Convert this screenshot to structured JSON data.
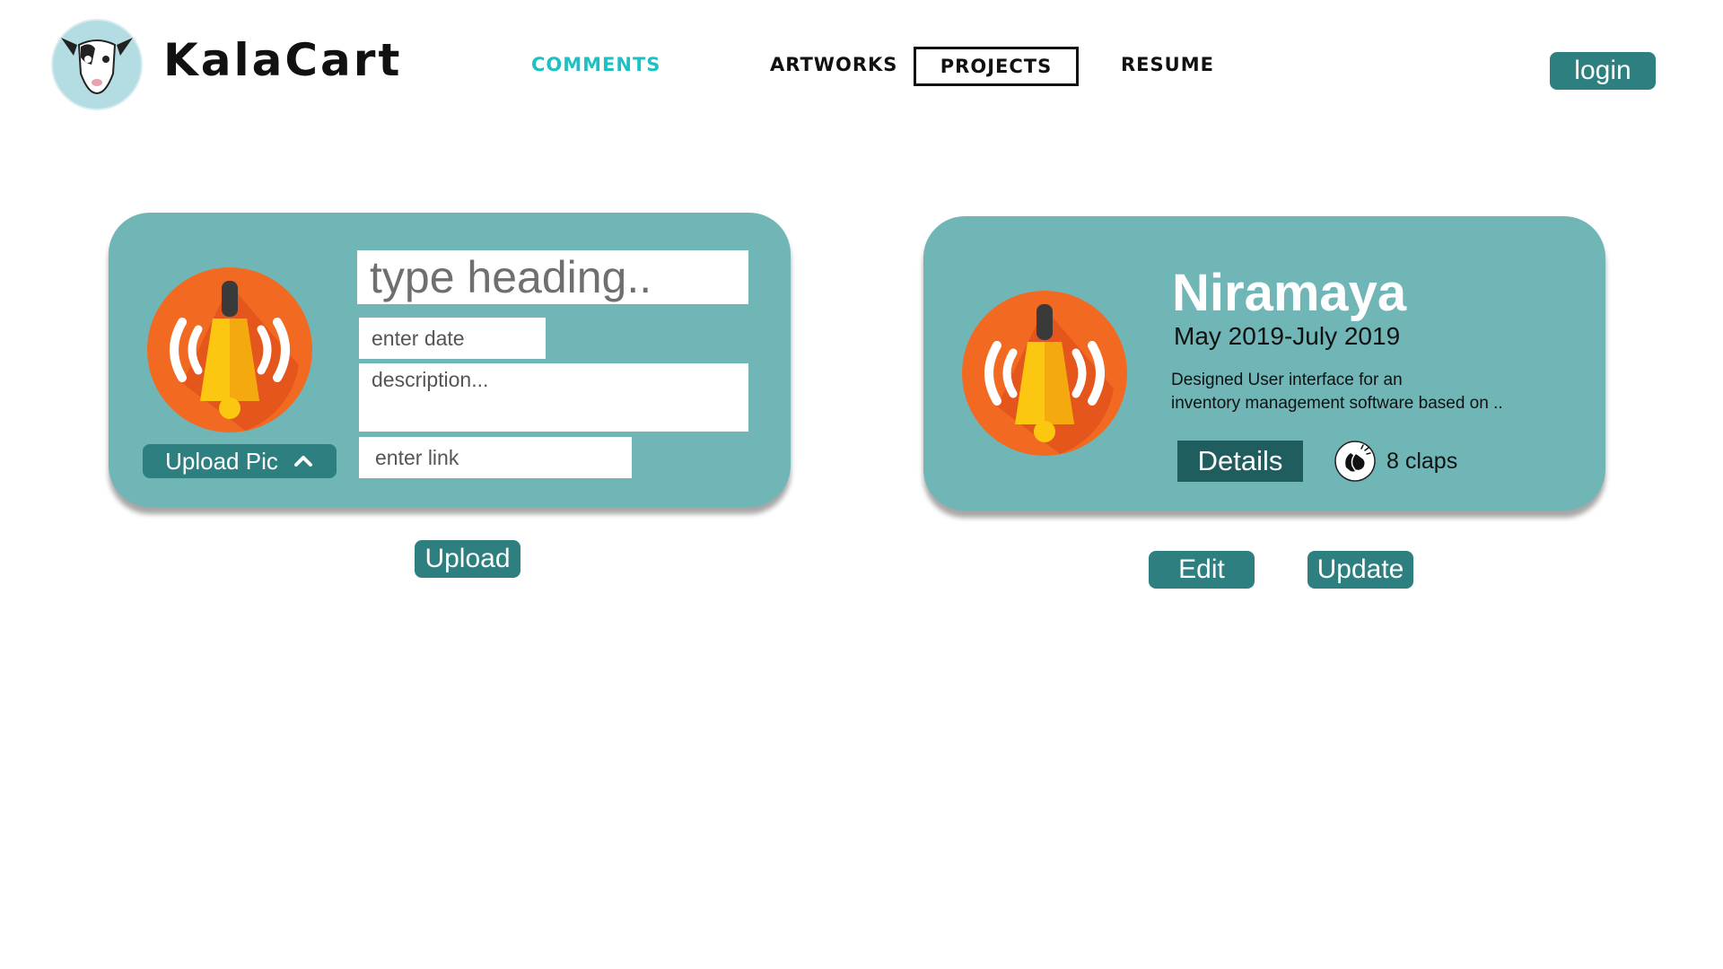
{
  "brand": {
    "name": "KalaCart",
    "logo_icon": "goat-logo-icon"
  },
  "nav": {
    "comments": "COMMENTS",
    "artworks": "ARTWORKS",
    "projects": "PROJECTS",
    "resume": "RESUME",
    "active": "COMMENTS"
  },
  "header": {
    "login_label": "login"
  },
  "editor": {
    "heading_placeholder": "type heading..",
    "date_placeholder": "enter date",
    "description_placeholder": "description...",
    "link_placeholder": "enter link",
    "upload_pic_label": "Upload Pic",
    "upload_label": "Upload",
    "image_icon": "alarm-bell-icon"
  },
  "project": {
    "title": "Niramaya",
    "date_range": "May 2019-July 2019",
    "description_line1": "Designed User interface for an",
    "description_line2": "inventory management software based on ..",
    "details_label": "Details",
    "claps": "8 claps",
    "edit_label": "Edit",
    "update_label": "Update",
    "image_icon": "alarm-bell-icon"
  },
  "colors": {
    "card_bg": "#70b6b7",
    "button_bg": "#2e7f80",
    "details_bg": "#1f5d5e",
    "nav_active": "#1fc0c4"
  }
}
